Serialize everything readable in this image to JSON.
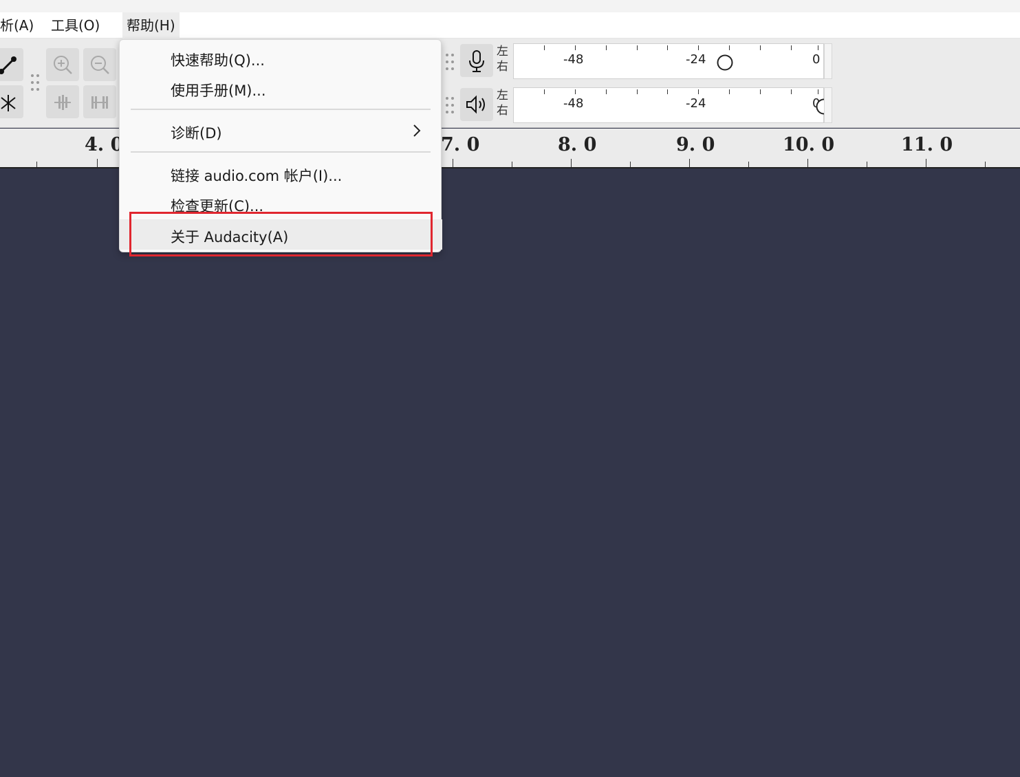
{
  "menubar": {
    "items": [
      {
        "label": "析(A)"
      },
      {
        "label": "工具(O)"
      },
      {
        "label": "帮助(H)"
      }
    ]
  },
  "meters": {
    "record": {
      "left_label": "左",
      "right_label": "右",
      "scale": [
        "-48",
        "-24",
        "0"
      ]
    },
    "playback": {
      "left_label": "左",
      "right_label": "右",
      "scale": [
        "-48",
        "-24",
        "0"
      ]
    }
  },
  "ruler": {
    "labels": [
      "4. 0",
      "7. 0",
      "8. 0",
      "9. 0",
      "10. 0",
      "11. 0"
    ]
  },
  "help_menu": {
    "items": [
      {
        "label": "快速帮助(Q)..."
      },
      {
        "label": "使用手册(M)..."
      },
      {
        "label": "诊断(D)"
      },
      {
        "label": "链接 audio.com 帐户(I)..."
      },
      {
        "label": "检查更新(C)..."
      },
      {
        "label": "关于 Audacity(A)"
      }
    ]
  },
  "colors": {
    "workspace": "#33364a",
    "highlight_box": "#e0262f"
  }
}
